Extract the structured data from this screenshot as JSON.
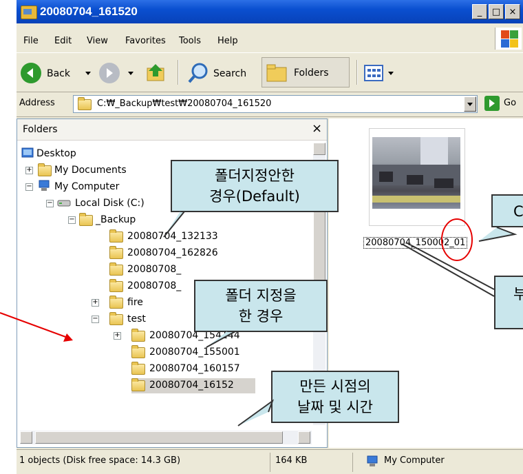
{
  "window": {
    "title": "20080704_161520",
    "controls": [
      "_",
      "□",
      "×"
    ]
  },
  "menu": [
    "File",
    "Edit",
    "View",
    "Favorites",
    "Tools",
    "Help"
  ],
  "toolbar": {
    "back": "Back",
    "search": "Search",
    "folders": "Folders"
  },
  "address": {
    "label": "Address",
    "value": "C:₩_Backup₩test₩20080704_161520",
    "go": "Go"
  },
  "folders_pane": {
    "title": "Folders",
    "close": "×",
    "items": [
      {
        "label": "Desktop",
        "expander": ""
      },
      {
        "label": "My Documents",
        "expander": "+"
      },
      {
        "label": "My Computer",
        "expander": "−"
      },
      {
        "label": "Local Disk (C:)",
        "expander": "−"
      },
      {
        "label": "_Backup",
        "expander": "−"
      },
      {
        "label": "20080704_132133",
        "expander": ""
      },
      {
        "label": "20080704_162826",
        "expander": ""
      },
      {
        "label": "20080708_",
        "expander": ""
      },
      {
        "label": "20080708_",
        "expander": ""
      },
      {
        "label": "fire",
        "expander": "+"
      },
      {
        "label": "test",
        "expander": "−"
      },
      {
        "label": "20080704_154144",
        "expander": "+"
      },
      {
        "label": "20080704_155001",
        "expander": ""
      },
      {
        "label": "20080704_160157",
        "expander": ""
      },
      {
        "label": "20080704_16152",
        "expander": ""
      }
    ]
  },
  "file_view": {
    "caption": "20080704_150002_01"
  },
  "status": {
    "objects": "1 objects (Disk free space: 14.3 GB)",
    "size": "164 KB",
    "location": "My Computer"
  },
  "callouts": {
    "default_folder": "폴더지정안한\n경우(Default)",
    "designated_folder": "폴더 지정을\n한 경우",
    "created_time": "만든 시점의\n날짜 및 시간",
    "right_top": "C",
    "right_mid": "부"
  },
  "colors": {
    "title_bar": "#0a4fd0",
    "callout_fill": "#c9e6ec",
    "annotation_red": "#e60000"
  }
}
